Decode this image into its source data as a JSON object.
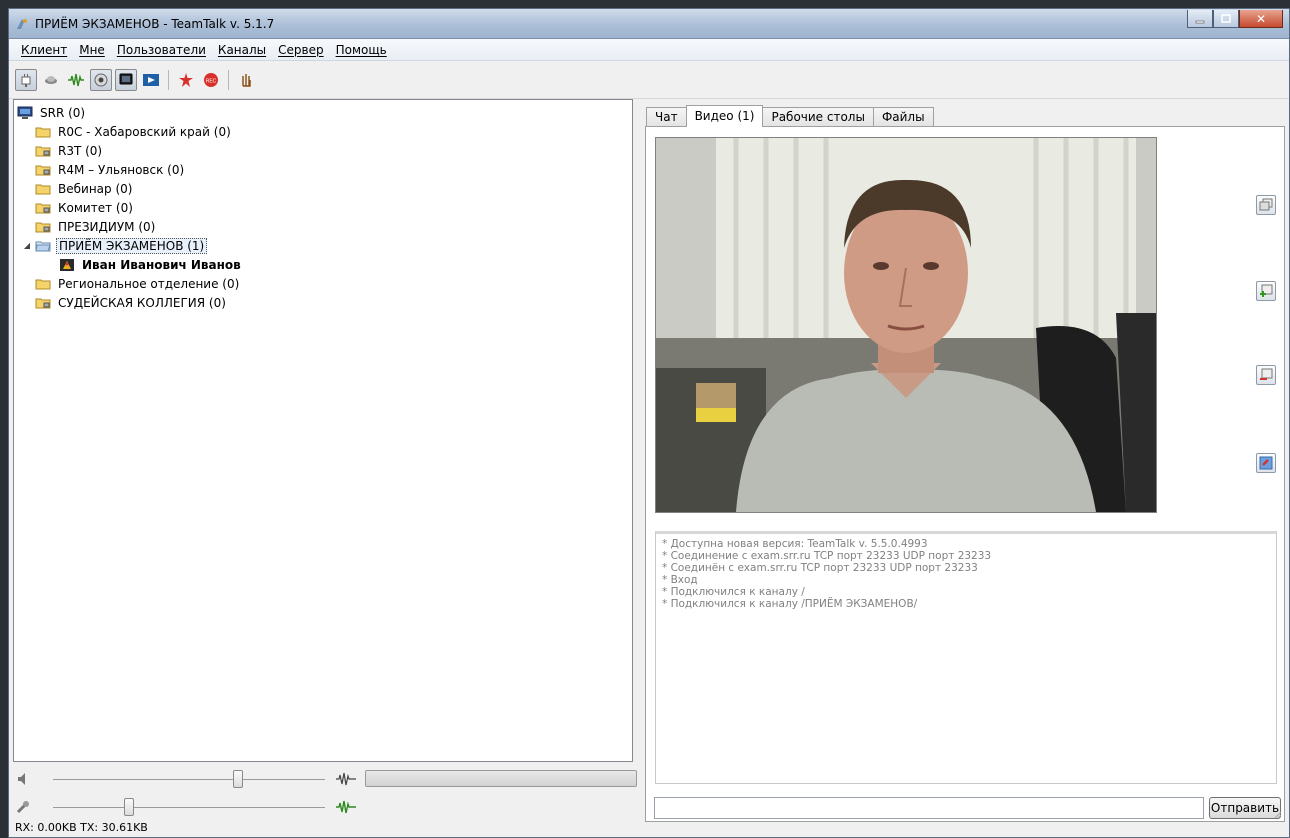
{
  "window": {
    "title": "ПРИЁМ ЭКЗАМЕНОВ - TeamTalk v. 5.1.7"
  },
  "menu": {
    "items": [
      "Клиент",
      "Мне",
      "Пользователи",
      "Каналы",
      "Сервер",
      "Помощь"
    ]
  },
  "toolbar": {
    "buttons": [
      {
        "icon": "connect-plug-icon",
        "pressed": true
      },
      {
        "icon": "speaker-icon",
        "pressed": false
      },
      {
        "icon": "voice-activation-icon",
        "pressed": false
      },
      {
        "icon": "webcam-icon",
        "pressed": true
      },
      {
        "icon": "desktop-share-icon",
        "pressed": true
      },
      {
        "icon": "video-file-icon",
        "pressed": false
      },
      {
        "icon": "push-to-talk-stop-icon",
        "pressed": false
      },
      {
        "icon": "record-icon",
        "pressed": false
      },
      {
        "icon": "raise-hand-icon",
        "pressed": false
      }
    ]
  },
  "tree": {
    "server": "SRR (0)",
    "channels": [
      {
        "label": "R0C - Хабаровский край (0)",
        "icon": "folder-icon"
      },
      {
        "label": "R3T (0)",
        "icon": "locked-folder-icon"
      },
      {
        "label": "R4M – Ульяновск (0)",
        "icon": "locked-folder-icon"
      },
      {
        "label": "Вебинар (0)",
        "icon": "folder-icon"
      },
      {
        "label": "Комитет (0)",
        "icon": "locked-folder-icon"
      },
      {
        "label": "ПРЕЗИДИУМ (0)",
        "icon": "locked-folder-icon"
      },
      {
        "label": "ПРИЁМ ЭКЗАМЕНОВ (1)",
        "icon": "open-folder-icon",
        "selected": true,
        "expanded": true
      },
      {
        "label": "Иван Иванович Иванов",
        "icon": "user-icon",
        "user": true
      },
      {
        "label": "Региональное отделение (0)",
        "icon": "folder-icon"
      },
      {
        "label": "СУДЕЙСКАЯ КОЛЛЕГИЯ (0)",
        "icon": "locked-folder-icon"
      }
    ]
  },
  "audio": {
    "volume_level": 0.68,
    "mic_level": 0.28,
    "voice_meter_fill": 0.0
  },
  "status": {
    "text": "RX: 0.00KB TX: 30.61KB"
  },
  "tabs": [
    {
      "label": "Чат",
      "active": false
    },
    {
      "label": "Видео (1)",
      "active": true
    },
    {
      "label": "Рабочие столы",
      "active": false
    },
    {
      "label": "Файлы",
      "active": false
    }
  ],
  "log": {
    "lines": [
      "* Доступна новая версия: TeamTalk v. 5.5.0.4993",
      "* Соединение с exam.srr.ru TCP порт 23233 UDP порт 23233",
      "* Соединён с exam.srr.ru TCP порт 23233 UDP порт 23233",
      "* Вход",
      "* Подключился к каналу /",
      "* Подключился к каналу /ПРИЁМ ЭКЗАМЕНОВ/"
    ]
  },
  "chat": {
    "input_value": "",
    "send_label": "Отправить"
  }
}
